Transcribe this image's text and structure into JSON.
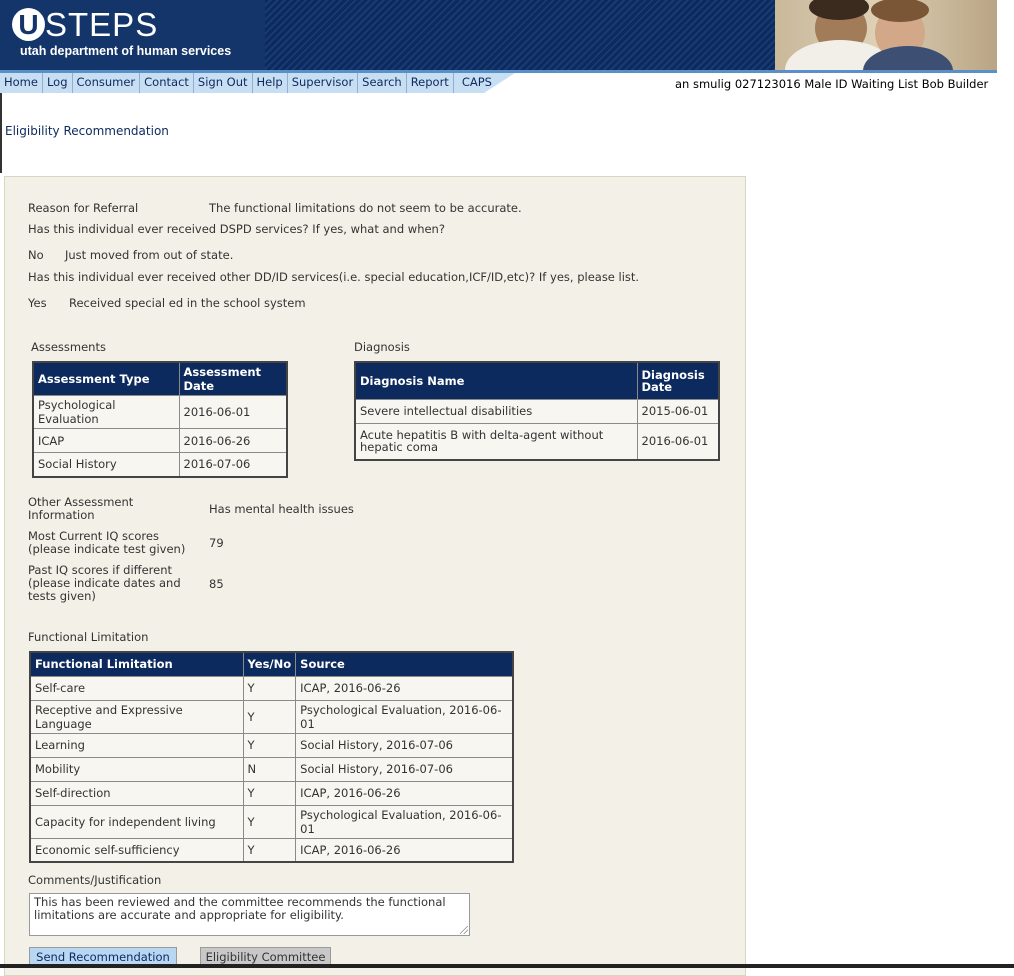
{
  "header": {
    "logo_letter": "U",
    "logo_rest": "STEPS",
    "department": "utah department of human services"
  },
  "nav": {
    "items": [
      "Home",
      "Log",
      "Consumer",
      "Contact",
      "Sign Out",
      "Help",
      "Supervisor",
      "Search",
      "Report",
      "CAPS"
    ]
  },
  "user_info": "an smulig 027123016 Male ID Waiting List Bob Builder",
  "page_title": "Eligibility Recommendation",
  "referral": {
    "reason_label": "Reason for Referral",
    "reason_value": "The functional limitations do not seem to be accurate.",
    "dspd_question": "Has this individual ever received DSPD services? If yes, what and when?",
    "dspd_answer": "No",
    "dspd_detail": "Just moved from out of state.",
    "other_question": "Has this individual ever received other DD/ID services(i.e. special education,ICF/ID,etc)? If yes, please list.",
    "other_answer": "Yes",
    "other_detail": "Received special ed in the school system"
  },
  "assessments": {
    "title": "Assessments",
    "headers": [
      "Assessment Type",
      "Assessment Date"
    ],
    "rows": [
      [
        "Psychological Evaluation",
        "2016-06-01"
      ],
      [
        "ICAP",
        "2016-06-26"
      ],
      [
        "Social History",
        "2016-07-06"
      ]
    ]
  },
  "diagnosis": {
    "title": "Diagnosis",
    "headers": [
      "Diagnosis Name",
      "Diagnosis Date"
    ],
    "rows": [
      [
        "Severe intellectual disabilities",
        "2015-06-01"
      ],
      [
        "Acute hepatitis B with delta-agent without hepatic coma",
        "2016-06-01"
      ]
    ]
  },
  "other_info": {
    "other_assessment_label": "Other Assessment Information",
    "other_assessment_value": "Has mental health issues",
    "current_iq_label": "Most Current IQ scores (please indicate test given)",
    "current_iq_value": "79",
    "past_iq_label": "Past IQ scores if different (please indicate dates and tests given)",
    "past_iq_value": "85"
  },
  "functional": {
    "title": "Functional Limitation",
    "headers": [
      "Functional Limitation",
      "Yes/No",
      "Source"
    ],
    "rows": [
      [
        "Self-care",
        "Y",
        "ICAP, 2016-06-26"
      ],
      [
        "Receptive and Expressive Language",
        "Y",
        "Psychological Evaluation, 2016-06-01"
      ],
      [
        "Learning",
        "Y",
        "Social History, 2016-07-06"
      ],
      [
        "Mobility",
        "N",
        "Social History, 2016-07-06"
      ],
      [
        "Self-direction",
        "Y",
        "ICAP, 2016-06-26"
      ],
      [
        "Capacity for independent living",
        "Y",
        "Psychological Evaluation, 2016-06-01"
      ],
      [
        "Economic self-sufficiency",
        "Y",
        "ICAP, 2016-06-26"
      ]
    ]
  },
  "comments": {
    "label": "Comments/Justification",
    "text": "This has been reviewed and the committee recommends the functional limitations are accurate and appropriate for eligibility."
  },
  "buttons": {
    "send": "Send Recommendation",
    "committee": "Eligibility Committee"
  }
}
